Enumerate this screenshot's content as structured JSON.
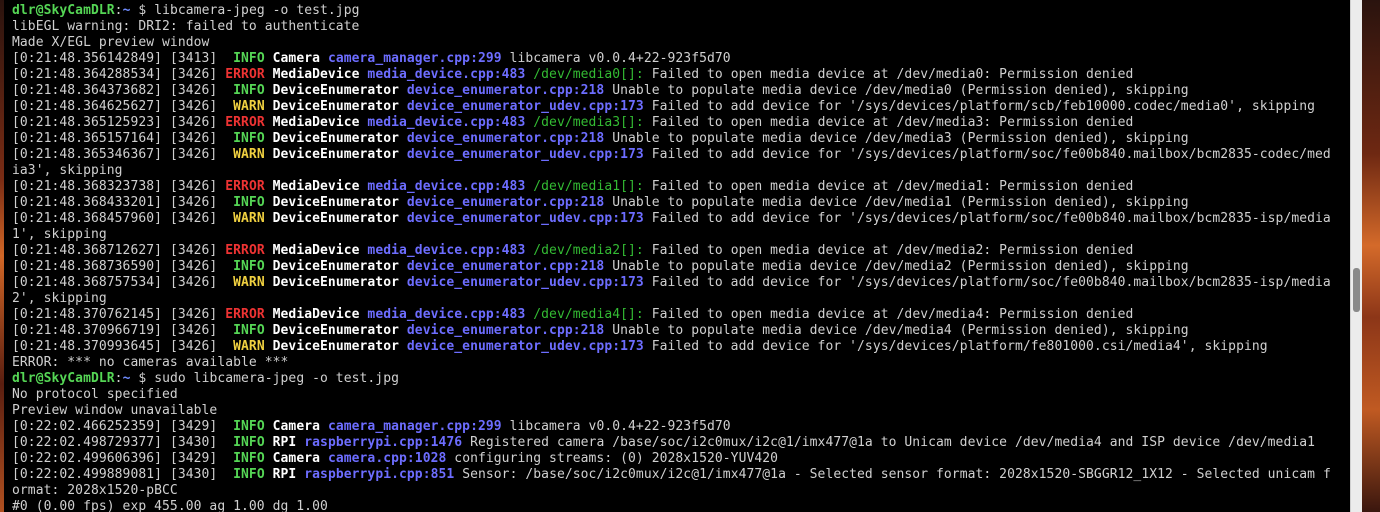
{
  "prompt1": {
    "user": "dlr@SkyCamDLR",
    "sep": ":",
    "path": "~",
    "dollar": " $ ",
    "command": "libcamera-jpeg -o test.jpg"
  },
  "output_pre1": [
    "libEGL warning: DRI2: failed to authenticate",
    "Made X/EGL preview window"
  ],
  "log1": [
    {
      "time": "[0:21:48.356142849]",
      "pid": "[3413]",
      "level": "INFO",
      "category": "Camera",
      "file": "camera_manager.cpp:299",
      "device": "",
      "message": "libcamera v0.0.4+22-923f5d70"
    },
    {
      "time": "[0:21:48.364288534]",
      "pid": "[3426]",
      "level": "ERROR",
      "category": "MediaDevice",
      "file": "media_device.cpp:483",
      "device": "/dev/media0[]:",
      "message": "Failed to open media device at /dev/media0: Permission denied"
    },
    {
      "time": "[0:21:48.364373682]",
      "pid": "[3426]",
      "level": "INFO",
      "category": "DeviceEnumerator",
      "file": "device_enumerator.cpp:218",
      "device": "",
      "message": "Unable to populate media device /dev/media0 (Permission denied), skipping"
    },
    {
      "time": "[0:21:48.364625627]",
      "pid": "[3426]",
      "level": "WARN",
      "category": "DeviceEnumerator",
      "file": "device_enumerator_udev.cpp:173",
      "device": "",
      "message": "Failed to add device for '/sys/devices/platform/scb/feb10000.codec/media0', skipping"
    },
    {
      "time": "[0:21:48.365125923]",
      "pid": "[3426]",
      "level": "ERROR",
      "category": "MediaDevice",
      "file": "media_device.cpp:483",
      "device": "/dev/media3[]:",
      "message": "Failed to open media device at /dev/media3: Permission denied"
    },
    {
      "time": "[0:21:48.365157164]",
      "pid": "[3426]",
      "level": "INFO",
      "category": "DeviceEnumerator",
      "file": "device_enumerator.cpp:218",
      "device": "",
      "message": "Unable to populate media device /dev/media3 (Permission denied), skipping"
    },
    {
      "time": "[0:21:48.365346367]",
      "pid": "[3426]",
      "level": "WARN",
      "category": "DeviceEnumerator",
      "file": "device_enumerator_udev.cpp:173",
      "device": "",
      "message": "Failed to add device for '/sys/devices/platform/soc/fe00b840.mailbox/bcm2835-codec/med",
      "wrap": "ia3', skipping"
    },
    {
      "time": "[0:21:48.368323738]",
      "pid": "[3426]",
      "level": "ERROR",
      "category": "MediaDevice",
      "file": "media_device.cpp:483",
      "device": "/dev/media1[]:",
      "message": "Failed to open media device at /dev/media1: Permission denied"
    },
    {
      "time": "[0:21:48.368433201]",
      "pid": "[3426]",
      "level": "INFO",
      "category": "DeviceEnumerator",
      "file": "device_enumerator.cpp:218",
      "device": "",
      "message": "Unable to populate media device /dev/media1 (Permission denied), skipping"
    },
    {
      "time": "[0:21:48.368457960]",
      "pid": "[3426]",
      "level": "WARN",
      "category": "DeviceEnumerator",
      "file": "device_enumerator_udev.cpp:173",
      "device": "",
      "message": "Failed to add device for '/sys/devices/platform/soc/fe00b840.mailbox/bcm2835-isp/media",
      "wrap": "1', skipping"
    },
    {
      "time": "[0:21:48.368712627]",
      "pid": "[3426]",
      "level": "ERROR",
      "category": "MediaDevice",
      "file": "media_device.cpp:483",
      "device": "/dev/media2[]:",
      "message": "Failed to open media device at /dev/media2: Permission denied"
    },
    {
      "time": "[0:21:48.368736590]",
      "pid": "[3426]",
      "level": "INFO",
      "category": "DeviceEnumerator",
      "file": "device_enumerator.cpp:218",
      "device": "",
      "message": "Unable to populate media device /dev/media2 (Permission denied), skipping"
    },
    {
      "time": "[0:21:48.368757534]",
      "pid": "[3426]",
      "level": "WARN",
      "category": "DeviceEnumerator",
      "file": "device_enumerator_udev.cpp:173",
      "device": "",
      "message": "Failed to add device for '/sys/devices/platform/soc/fe00b840.mailbox/bcm2835-isp/media",
      "wrap": "2', skipping"
    },
    {
      "time": "[0:21:48.370762145]",
      "pid": "[3426]",
      "level": "ERROR",
      "category": "MediaDevice",
      "file": "media_device.cpp:483",
      "device": "/dev/media4[]:",
      "message": "Failed to open media device at /dev/media4: Permission denied"
    },
    {
      "time": "[0:21:48.370966719]",
      "pid": "[3426]",
      "level": "INFO",
      "category": "DeviceEnumerator",
      "file": "device_enumerator.cpp:218",
      "device": "",
      "message": "Unable to populate media device /dev/media4 (Permission denied), skipping"
    },
    {
      "time": "[0:21:48.370993645]",
      "pid": "[3426]",
      "level": "WARN",
      "category": "DeviceEnumerator",
      "file": "device_enumerator_udev.cpp:173",
      "device": "",
      "message": "Failed to add device for '/sys/devices/platform/fe801000.csi/media4', skipping"
    }
  ],
  "output_post1": [
    "ERROR: *** no cameras available ***"
  ],
  "prompt2": {
    "user": "dlr@SkyCamDLR",
    "sep": ":",
    "path": "~",
    "dollar": " $ ",
    "command": "sudo libcamera-jpeg -o test.jpg"
  },
  "output_pre2": [
    "No protocol specified",
    "Preview window unavailable"
  ],
  "log2": [
    {
      "time": "[0:22:02.466252359]",
      "pid": "[3429]",
      "level": "INFO",
      "category": "Camera",
      "file": "camera_manager.cpp:299",
      "device": "",
      "message": "libcamera v0.0.4+22-923f5d70"
    },
    {
      "time": "[0:22:02.498729377]",
      "pid": "[3430]",
      "level": "INFO",
      "category": "RPI",
      "file": "raspberrypi.cpp:1476",
      "device": "",
      "message": "Registered camera /base/soc/i2c0mux/i2c@1/imx477@1a to Unicam device /dev/media4 and ISP device /dev/media1"
    },
    {
      "time": "[0:22:02.499606396]",
      "pid": "[3429]",
      "level": "INFO",
      "category": "Camera",
      "file": "camera.cpp:1028",
      "device": "",
      "message": "configuring streams: (0) 2028x1520-YUV420"
    },
    {
      "time": "[0:22:02.499889081]",
      "pid": "[3430]",
      "level": "INFO",
      "category": "RPI",
      "file": "raspberrypi.cpp:851",
      "device": "",
      "message": "Sensor: /base/soc/i2c0mux/i2c@1/imx477@1a - Selected sensor format: 2028x1520-SBGGR12_1X12 - Selected unicam f",
      "wrap": "ormat: 2028x1520-pBCC"
    }
  ],
  "output_post2": [
    "#0 (0.00 fps) exp 455.00 ag 1.00 dg 1.00"
  ],
  "colors": {
    "terminal_bg": "#000000",
    "prompt_user": "#55d655",
    "prompt_path": "#6f8cff",
    "info": "#55d655",
    "warn": "#f0d040",
    "error": "#ee3333",
    "file_link": "#6d6dff",
    "device": "#33bb33",
    "text": "#d0d0d0"
  }
}
